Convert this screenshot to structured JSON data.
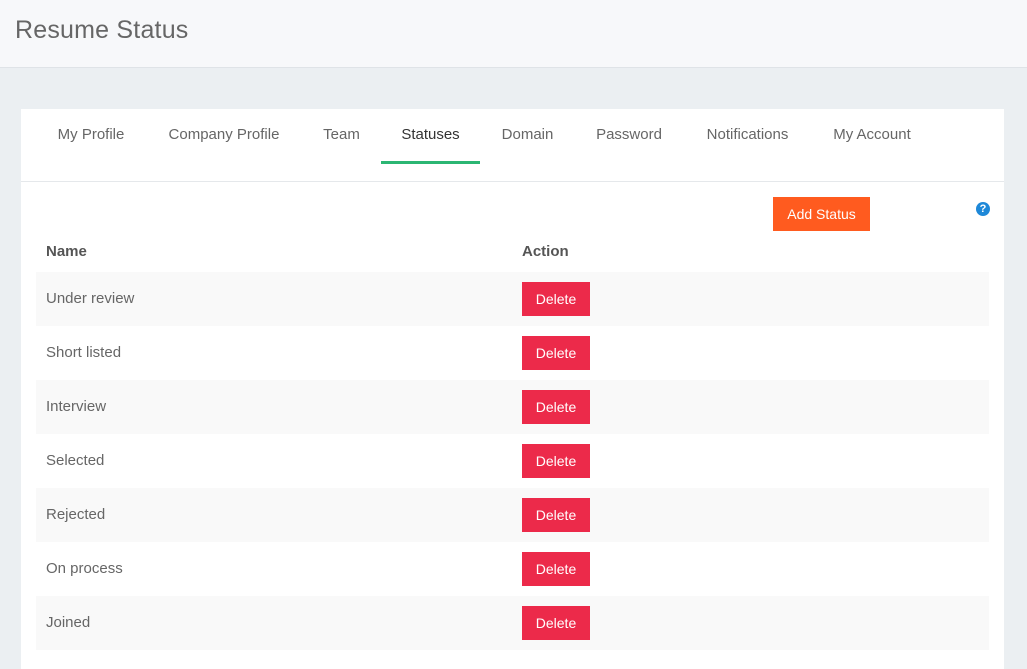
{
  "header": {
    "title": "Resume Status"
  },
  "tabs": [
    {
      "label": "My Profile"
    },
    {
      "label": "Company Profile"
    },
    {
      "label": "Team"
    },
    {
      "label": "Statuses",
      "active": true
    },
    {
      "label": "Domain"
    },
    {
      "label": "Password"
    },
    {
      "label": "Notifications"
    },
    {
      "label": "My Account"
    }
  ],
  "toolbar": {
    "add_label": "Add Status",
    "help_icon": "question-circle-icon",
    "help_glyph": "?"
  },
  "table": {
    "columns": [
      "Name",
      "Action"
    ],
    "rows": [
      {
        "name": "Under review",
        "action": "Delete"
      },
      {
        "name": "Short listed",
        "action": "Delete"
      },
      {
        "name": "Interview",
        "action": "Delete"
      },
      {
        "name": "Selected",
        "action": "Delete"
      },
      {
        "name": "Rejected",
        "action": "Delete"
      },
      {
        "name": "On process",
        "action": "Delete"
      },
      {
        "name": "Joined",
        "action": "Delete"
      }
    ]
  },
  "colors": {
    "accent_tab": "#2bb673",
    "add_button": "#ff5b1f",
    "delete_button": "#ec2a4a",
    "help_icon": "#1e88d8"
  }
}
